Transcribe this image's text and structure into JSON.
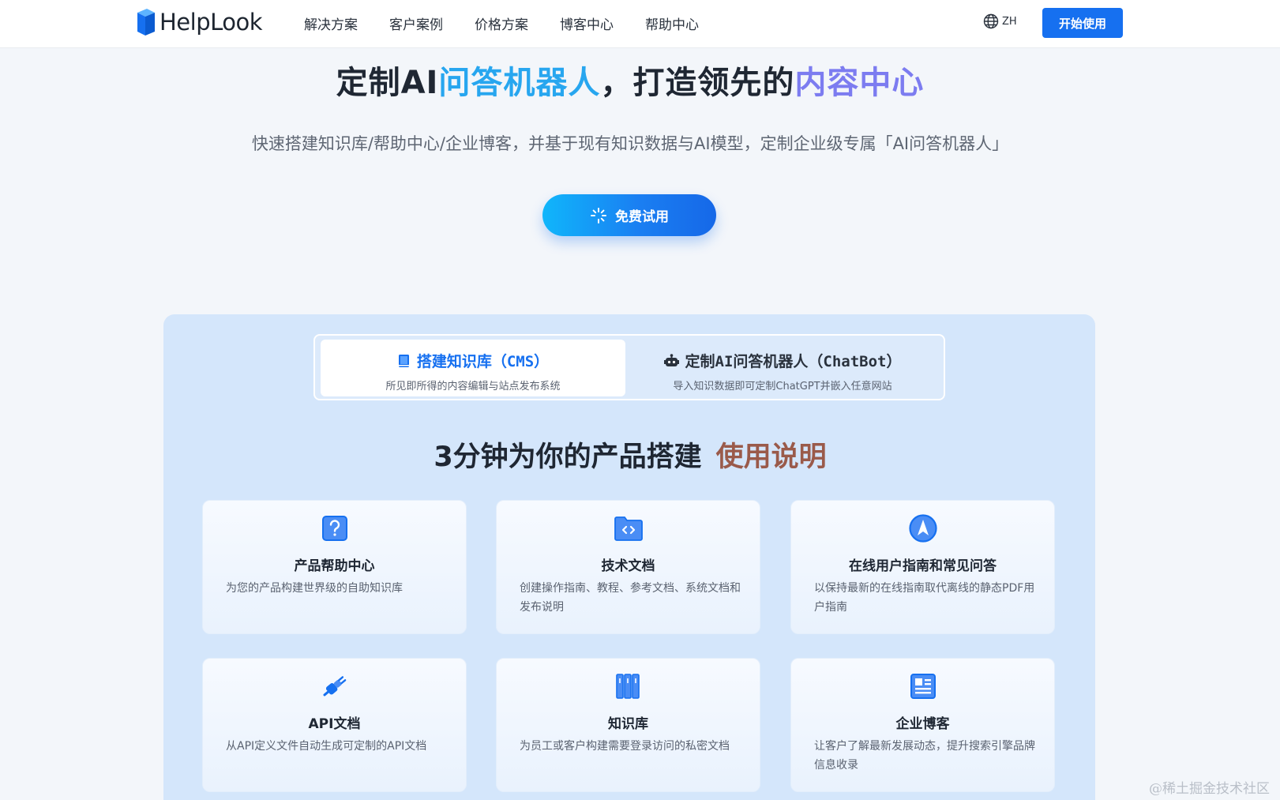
{
  "brand": {
    "name": "HelpLook"
  },
  "nav": {
    "items": [
      "解决方案",
      "客户案例",
      "价格方案",
      "博客中心",
      "帮助中心"
    ],
    "lang": "ZH",
    "start_label": "开始使用"
  },
  "hero": {
    "title_part1": "定制AI",
    "title_part2": "问答机器人",
    "title_part3": "，打造领先的",
    "title_part4": "内容中心",
    "subtitle": "快速搭建知识库/帮助中心/企业博客，并基于现有知识数据与AI模型，定制企业级专属「AI问答机器人」",
    "trial_label": "免费试用"
  },
  "tabs": [
    {
      "title": "搭建知识库（CMS）",
      "desc": "所见即所得的内容编辑与站点发布系统",
      "icon": "book-icon"
    },
    {
      "title": "定制AI问答机器人（ChatBot）",
      "desc": "导入知识数据即可定制ChatGPT并嵌入任意网站",
      "icon": "robot-icon"
    }
  ],
  "section": {
    "title": "3分钟为你的产品搭建",
    "accent": "使用说明"
  },
  "cards": [
    {
      "title": "产品帮助中心",
      "desc": "为您的产品构建世界级的自助知识库",
      "icon": "question-icon"
    },
    {
      "title": "技术文档",
      "desc": "创建操作指南、教程、参考文档、系统文档和发布说明",
      "icon": "code-folder-icon"
    },
    {
      "title": "在线用户指南和常见问答",
      "desc": "以保持最新的在线指南取代离线的静态PDF用户指南",
      "icon": "compass-icon"
    },
    {
      "title": "API文档",
      "desc": "从API定义文件自动生成可定制的API文档",
      "icon": "plug-icon"
    },
    {
      "title": "知识库",
      "desc": "为员工或客户构建需要登录访问的私密文档",
      "icon": "library-icon"
    },
    {
      "title": "企业博客",
      "desc": "让客户了解最新发展动态，提升搜索引擎品牌信息收录",
      "icon": "blog-layout-icon"
    }
  ],
  "watermark": "@稀土掘金技术社区",
  "colors": {
    "primary": "#1670f0",
    "panel": "#d4e6fb",
    "accent": "#9a5a4a"
  }
}
